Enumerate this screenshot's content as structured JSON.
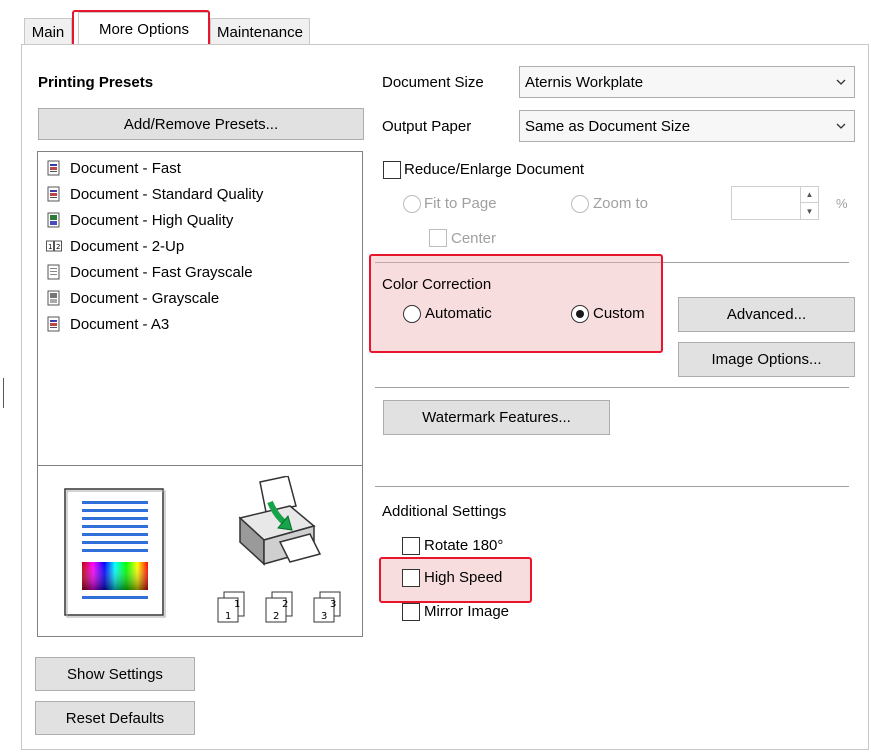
{
  "tabs": [
    "Main",
    "More Options",
    "Maintenance"
  ],
  "presets": {
    "title": "Printing Presets",
    "add_remove_label": "Add/Remove Presets...",
    "items": [
      "Document - Fast",
      "Document - Standard Quality",
      "Document - High Quality",
      "Document - 2-Up",
      "Document - Fast Grayscale",
      "Document - Grayscale",
      "Document - A3"
    ],
    "preview_icons": [
      "page-preview-icon",
      "printer-feed-icon"
    ],
    "collate_labels": [
      "1",
      "2",
      "3"
    ]
  },
  "left_buttons": {
    "show_settings": "Show Settings",
    "reset_defaults": "Reset Defaults"
  },
  "document_size": {
    "label": "Document Size",
    "value": "Aternis Workplate"
  },
  "output_paper": {
    "label": "Output Paper",
    "value": "Same as Document Size"
  },
  "reduce": {
    "label": "Reduce/Enlarge Document",
    "fit_to_page": "Fit to Page",
    "zoom_to": "Zoom to",
    "percent": "%",
    "center": "Center"
  },
  "color_correction": {
    "title": "Color Correction",
    "automatic": "Automatic",
    "custom": "Custom",
    "selected": "Custom",
    "advanced_label": "Advanced...",
    "image_options_label": "Image Options..."
  },
  "watermark_label": "Watermark Features...",
  "additional": {
    "title": "Additional Settings",
    "rotate": "Rotate 180°",
    "high_speed": "High Speed",
    "mirror": "Mirror Image"
  },
  "colors": {
    "highlight": "#e8152d",
    "highlight_fill": "#f0b4b9"
  }
}
